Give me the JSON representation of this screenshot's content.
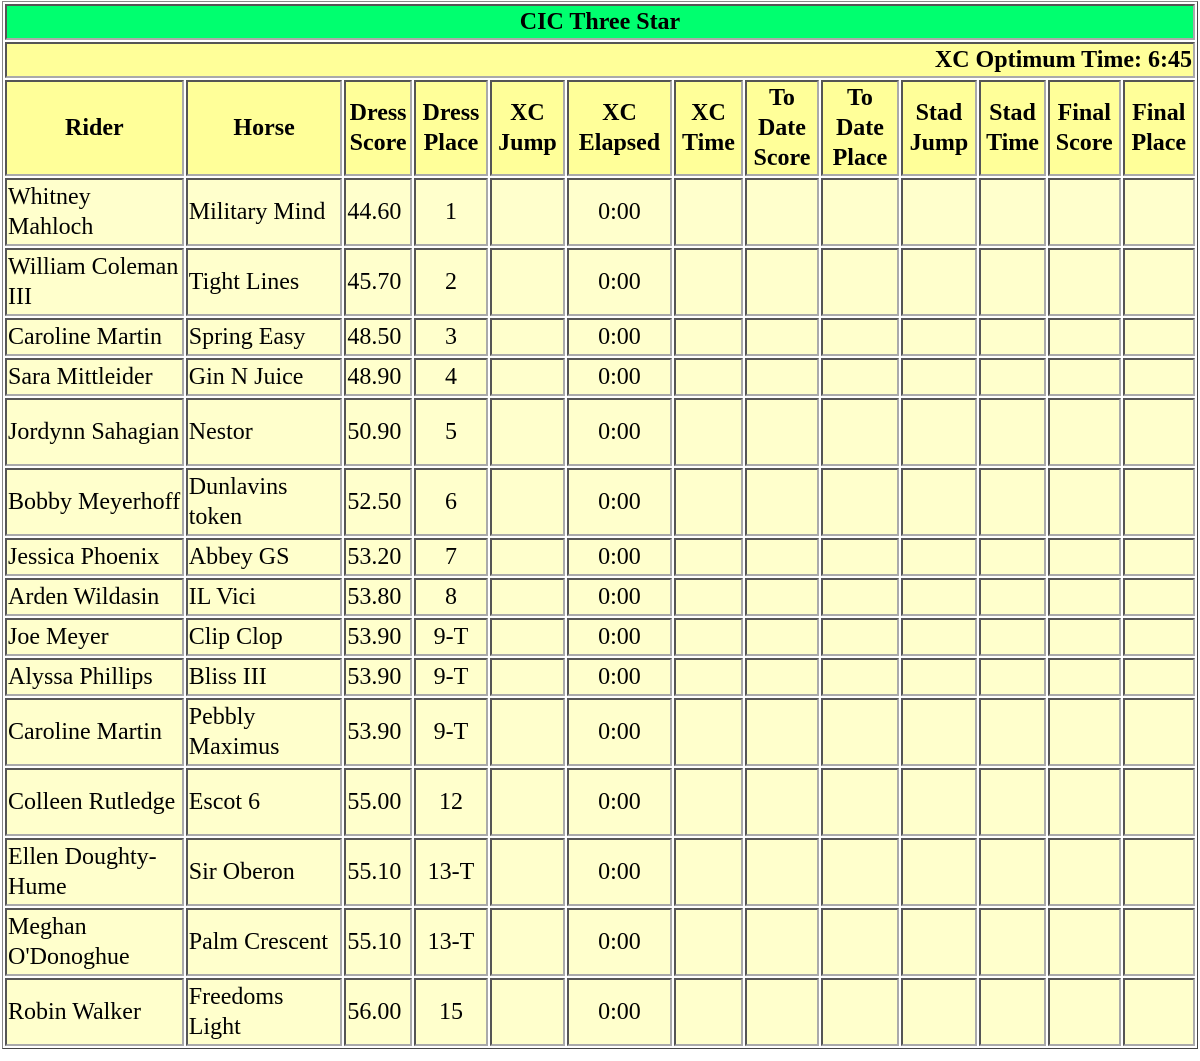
{
  "division": {
    "title": "CIC Three Star",
    "optimum_time_label": "XC Optimum Time: 6:45"
  },
  "colors": {
    "title_bg": "#00ff6f",
    "header_bg": "#ffff99",
    "cell_bg": "#ffffcc"
  },
  "columns": [
    [
      "Rider"
    ],
    [
      "Horse"
    ],
    [
      "Dress",
      "Score"
    ],
    [
      "Dress",
      "Place"
    ],
    [
      "XC",
      "Jump"
    ],
    [
      "XC",
      "Elapsed"
    ],
    [
      "XC",
      "Time"
    ],
    [
      "To",
      "Date",
      "Score"
    ],
    [
      "To",
      "Date",
      "Place"
    ],
    [
      "Stad",
      "Jump"
    ],
    [
      "Stad",
      "Time"
    ],
    [
      "Final",
      "Score"
    ],
    [
      "Final",
      "Place"
    ]
  ],
  "rows": [
    {
      "rider": "Whitney Mahloch",
      "horse": "Military Mind",
      "dress_score": "44.60",
      "dress_place": "1",
      "xc_jump": "",
      "xc_elapsed": "0:00",
      "xc_time": "",
      "to_date_score": "",
      "to_date_place": "",
      "stad_jump": "",
      "stad_time": "",
      "final_score": "",
      "final_place": ""
    },
    {
      "rider": "William Coleman III",
      "horse": "Tight Lines",
      "dress_score": "45.70",
      "dress_place": "2",
      "xc_jump": "",
      "xc_elapsed": "0:00",
      "xc_time": "",
      "to_date_score": "",
      "to_date_place": "",
      "stad_jump": "",
      "stad_time": "",
      "final_score": "",
      "final_place": ""
    },
    {
      "rider": "Caroline Martin",
      "horse": "Spring Easy",
      "dress_score": "48.50",
      "dress_place": "3",
      "xc_jump": "",
      "xc_elapsed": "0:00",
      "xc_time": "",
      "to_date_score": "",
      "to_date_place": "",
      "stad_jump": "",
      "stad_time": "",
      "final_score": "",
      "final_place": ""
    },
    {
      "rider": "Sara Mittleider",
      "horse": "Gin N Juice",
      "dress_score": "48.90",
      "dress_place": "4",
      "xc_jump": "",
      "xc_elapsed": "0:00",
      "xc_time": "",
      "to_date_score": "",
      "to_date_place": "",
      "stad_jump": "",
      "stad_time": "",
      "final_score": "",
      "final_place": ""
    },
    {
      "rider": "Jordynn Sahagian",
      "horse": "Nestor",
      "dress_score": "50.90",
      "dress_place": "5",
      "xc_jump": "",
      "xc_elapsed": "0:00",
      "xc_time": "",
      "to_date_score": "",
      "to_date_place": "",
      "stad_jump": "",
      "stad_time": "",
      "final_score": "",
      "final_place": ""
    },
    {
      "rider": "Bobby Meyerhoff",
      "horse": "Dunlavins token",
      "dress_score": "52.50",
      "dress_place": "6",
      "xc_jump": "",
      "xc_elapsed": "0:00",
      "xc_time": "",
      "to_date_score": "",
      "to_date_place": "",
      "stad_jump": "",
      "stad_time": "",
      "final_score": "",
      "final_place": ""
    },
    {
      "rider": "Jessica Phoenix",
      "horse": "Abbey GS",
      "dress_score": "53.20",
      "dress_place": "7",
      "xc_jump": "",
      "xc_elapsed": "0:00",
      "xc_time": "",
      "to_date_score": "",
      "to_date_place": "",
      "stad_jump": "",
      "stad_time": "",
      "final_score": "",
      "final_place": ""
    },
    {
      "rider": "Arden Wildasin",
      "horse": "IL Vici",
      "dress_score": "53.80",
      "dress_place": "8",
      "xc_jump": "",
      "xc_elapsed": "0:00",
      "xc_time": "",
      "to_date_score": "",
      "to_date_place": "",
      "stad_jump": "",
      "stad_time": "",
      "final_score": "",
      "final_place": ""
    },
    {
      "rider": "Joe Meyer",
      "horse": "Clip Clop",
      "dress_score": "53.90",
      "dress_place": "9-T",
      "xc_jump": "",
      "xc_elapsed": "0:00",
      "xc_time": "",
      "to_date_score": "",
      "to_date_place": "",
      "stad_jump": "",
      "stad_time": "",
      "final_score": "",
      "final_place": ""
    },
    {
      "rider": "Alyssa Phillips",
      "horse": "Bliss III",
      "dress_score": "53.90",
      "dress_place": "9-T",
      "xc_jump": "",
      "xc_elapsed": "0:00",
      "xc_time": "",
      "to_date_score": "",
      "to_date_place": "",
      "stad_jump": "",
      "stad_time": "",
      "final_score": "",
      "final_place": ""
    },
    {
      "rider": "Caroline Martin",
      "horse": "Pebbly Maximus",
      "dress_score": "53.90",
      "dress_place": "9-T",
      "xc_jump": "",
      "xc_elapsed": "0:00",
      "xc_time": "",
      "to_date_score": "",
      "to_date_place": "",
      "stad_jump": "",
      "stad_time": "",
      "final_score": "",
      "final_place": ""
    },
    {
      "rider": "Colleen Rutledge",
      "horse": "Escot 6",
      "dress_score": "55.00",
      "dress_place": "12",
      "xc_jump": "",
      "xc_elapsed": "0:00",
      "xc_time": "",
      "to_date_score": "",
      "to_date_place": "",
      "stad_jump": "",
      "stad_time": "",
      "final_score": "",
      "final_place": ""
    },
    {
      "rider": "Ellen Doughty-Hume",
      "horse": "Sir Oberon",
      "dress_score": "55.10",
      "dress_place": "13-T",
      "xc_jump": "",
      "xc_elapsed": "0:00",
      "xc_time": "",
      "to_date_score": "",
      "to_date_place": "",
      "stad_jump": "",
      "stad_time": "",
      "final_score": "",
      "final_place": ""
    },
    {
      "rider": "Meghan O'Donoghue",
      "horse": "Palm Crescent",
      "dress_score": "55.10",
      "dress_place": "13-T",
      "xc_jump": "",
      "xc_elapsed": "0:00",
      "xc_time": "",
      "to_date_score": "",
      "to_date_place": "",
      "stad_jump": "",
      "stad_time": "",
      "final_score": "",
      "final_place": ""
    },
    {
      "rider": "Robin Walker",
      "horse": "Freedoms Light",
      "dress_score": "56.00",
      "dress_place": "15",
      "xc_jump": "",
      "xc_elapsed": "0:00",
      "xc_time": "",
      "to_date_score": "",
      "to_date_place": "",
      "stad_jump": "",
      "stad_time": "",
      "final_score": "",
      "final_place": ""
    }
  ]
}
